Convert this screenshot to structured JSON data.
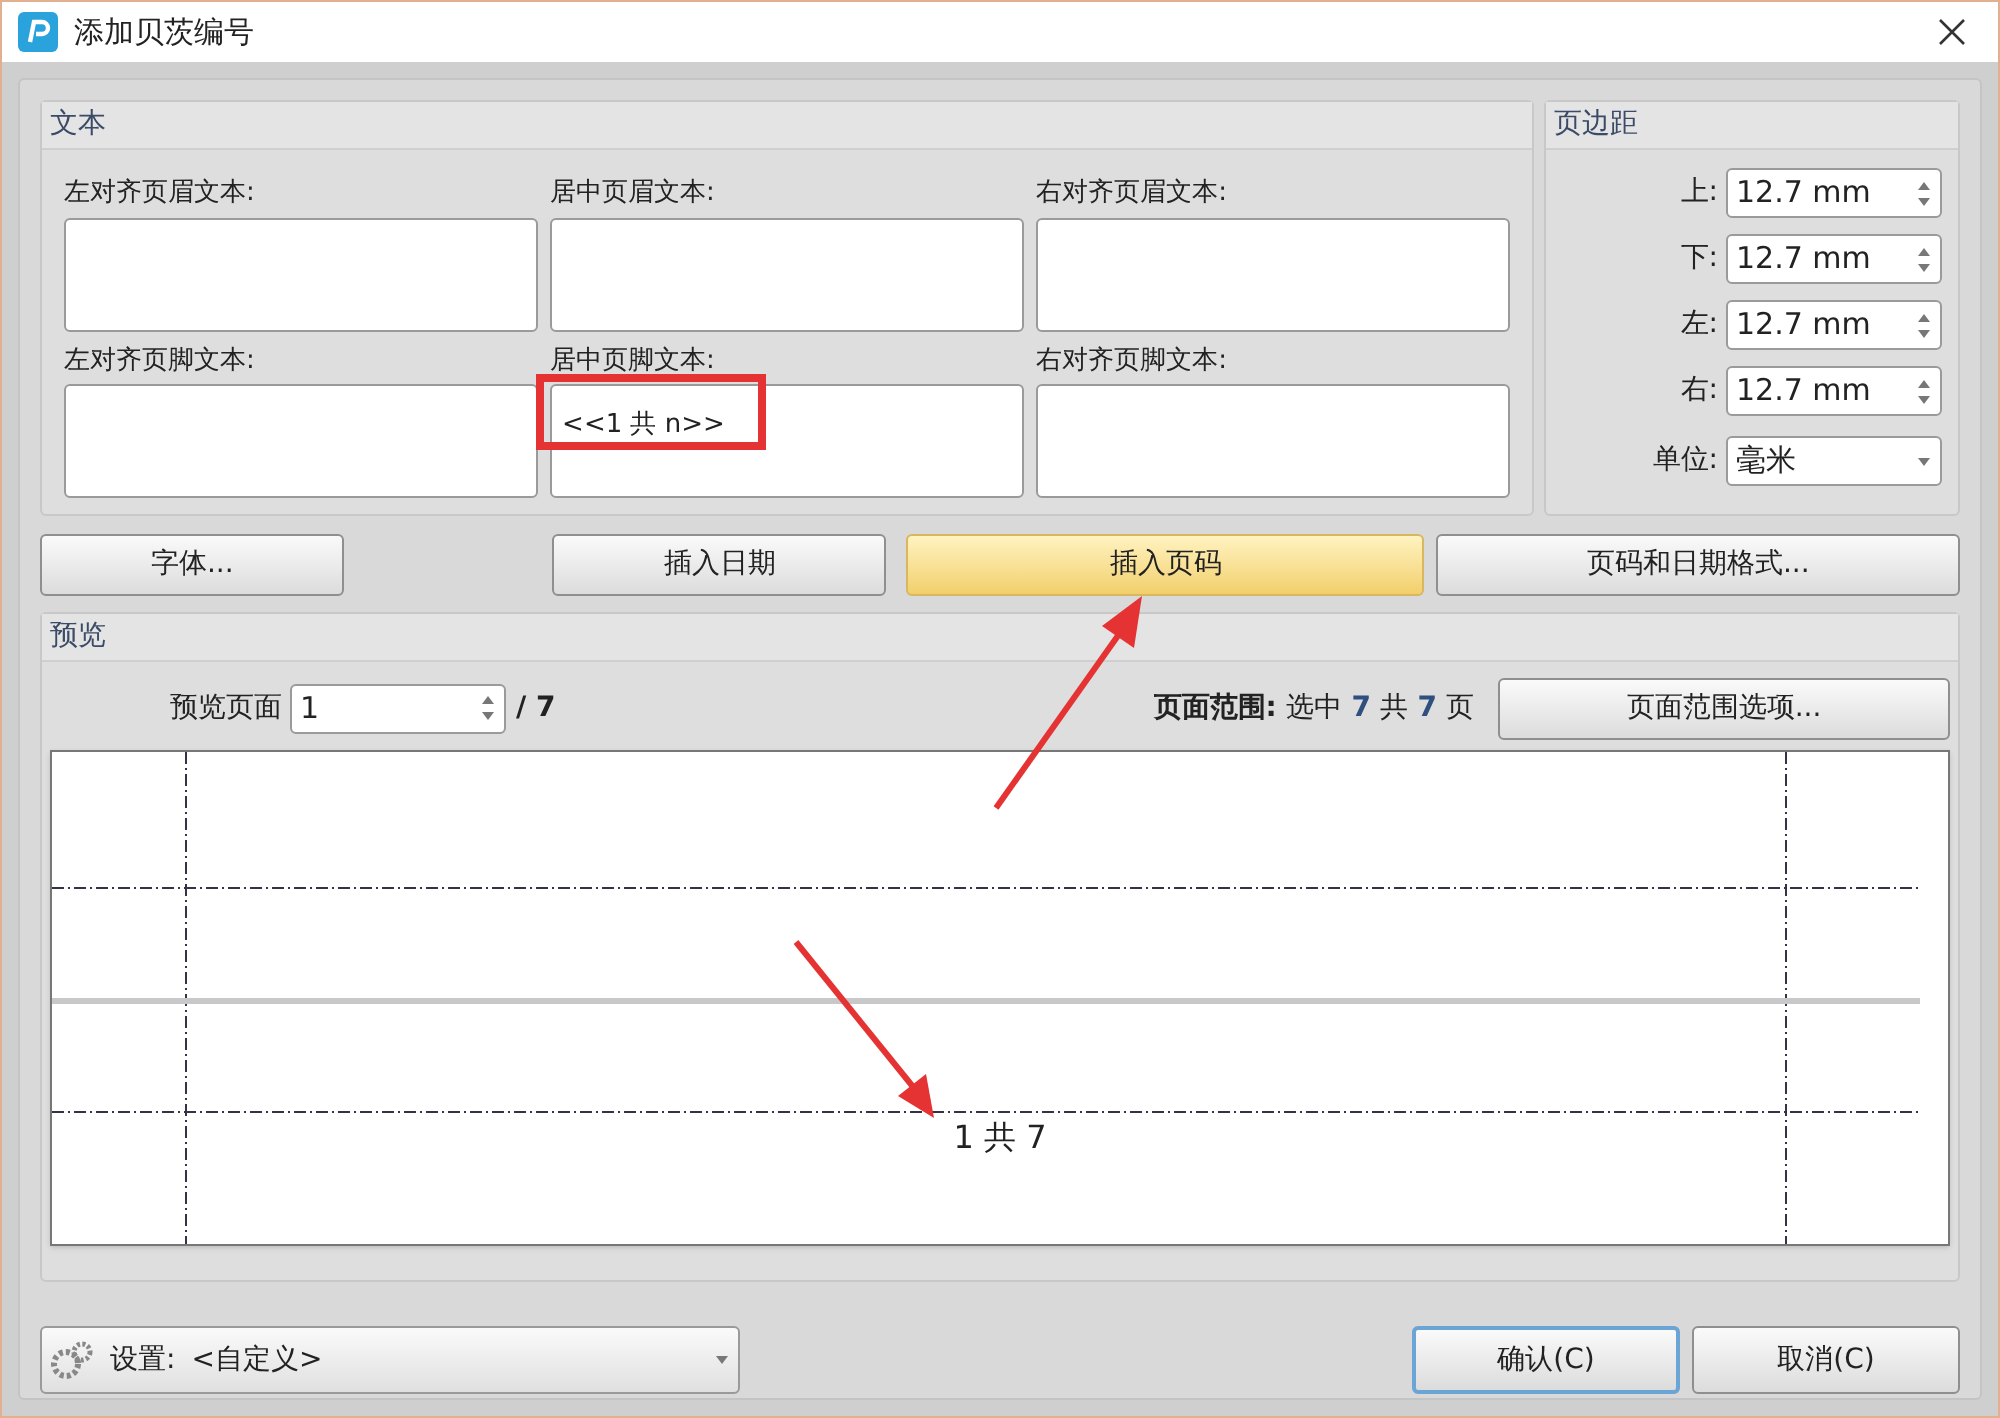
{
  "window": {
    "title": "添加贝茨编号"
  },
  "text_group": {
    "title": "文本",
    "fields": [
      {
        "label": "左对齐页眉文本:"
      },
      {
        "label": "居中页眉文本:"
      },
      {
        "label": "右对齐页眉文本:"
      },
      {
        "label": "左对齐页脚文本:"
      },
      {
        "label": "居中页脚文本:",
        "value": "<<1 共 n>>"
      },
      {
        "label": "右对齐页脚文本:"
      }
    ]
  },
  "margins": {
    "title": "页边距",
    "fields": [
      {
        "label": "上:",
        "value": "12.7 mm"
      },
      {
        "label": "下:",
        "value": "12.7 mm"
      },
      {
        "label": "左:",
        "value": "12.7 mm"
      },
      {
        "label": "右:",
        "value": "12.7 mm"
      }
    ],
    "unit": {
      "label": "单位:",
      "value": "毫米"
    }
  },
  "buttons": [
    {
      "label": "字体...",
      "highlighted": false
    },
    {
      "label": "插入日期",
      "highlighted": false
    },
    {
      "label": "插入页码",
      "highlighted": true
    },
    {
      "label": "页码和日期格式...",
      "highlighted": false
    }
  ],
  "preview": {
    "title": "预览",
    "page_label": "预览页面",
    "page_value": "1",
    "page_total": "/ 7",
    "range": [
      {
        "kind": "label",
        "text": "页面范围:"
      },
      {
        "kind": "text",
        "text": "选中"
      },
      {
        "kind": "number",
        "text": "7"
      },
      {
        "kind": "text",
        "text": "共"
      },
      {
        "kind": "number",
        "text": "7"
      },
      {
        "kind": "text",
        "text": "页"
      }
    ],
    "range_button": "页面范围选项...",
    "footer_text": "1 共 7"
  },
  "bottom": {
    "settings_label": "设置:",
    "settings_value": "<自定义>",
    "actions": [
      {
        "label": "确认(C)",
        "default": true
      },
      {
        "label": "取消(C)",
        "default": false
      }
    ]
  }
}
